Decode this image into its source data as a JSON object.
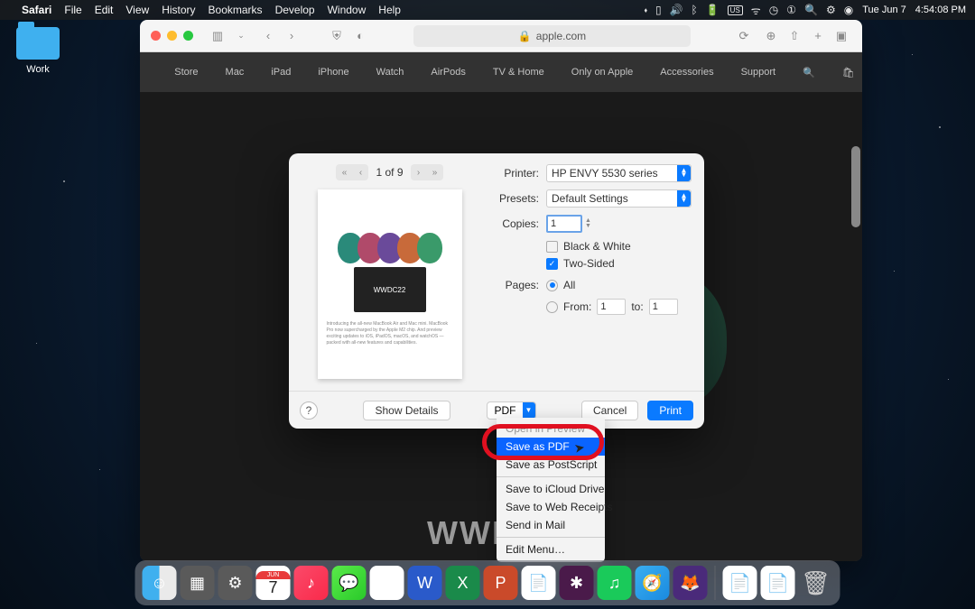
{
  "menubar": {
    "apple_glyph": "",
    "app_name": "Safari",
    "items": [
      "File",
      "Edit",
      "View",
      "History",
      "Bookmarks",
      "Develop",
      "Window",
      "Help"
    ],
    "date": "Tue Jun 7",
    "time": "4:54:08 PM"
  },
  "desktop": {
    "folder_name": "Work"
  },
  "safari": {
    "url_host": "apple.com",
    "lock_glyph": "🔒",
    "nav": [
      "Store",
      "Mac",
      "iPad",
      "iPhone",
      "Watch",
      "AirPods",
      "TV & Home",
      "Only on Apple",
      "Accessories",
      "Support"
    ],
    "wwdc_label": "WWDC22"
  },
  "print": {
    "page_indicator": "1 of 9",
    "preview_badge": "WWDC22",
    "labels": {
      "printer": "Printer:",
      "presets": "Presets:",
      "copies": "Copies:",
      "pages": "Pages:",
      "bw": "Black & White",
      "two_sided": "Two-Sided",
      "all": "All",
      "from": "From:",
      "to": "to:"
    },
    "printer_value": "HP ENVY 5530 series",
    "presets_value": "Default Settings",
    "copies_value": "1",
    "two_sided_checked": true,
    "bw_checked": false,
    "pages_all_selected": true,
    "from_value": "1",
    "to_value": "1",
    "help_glyph": "?",
    "show_details": "Show Details",
    "pdf_label": "PDF",
    "cancel": "Cancel",
    "print_btn": "Print"
  },
  "pdf_menu": {
    "open_preview": "Open in Preview",
    "save_pdf": "Save as PDF",
    "save_ps": "Save as PostScript",
    "save_icloud": "Save to iCloud Drive",
    "save_web": "Save to Web Receipts",
    "send_mail": "Send in Mail",
    "edit_menu": "Edit Menu…"
  },
  "dock": {
    "cal_month": "JUN",
    "cal_day": "7"
  }
}
